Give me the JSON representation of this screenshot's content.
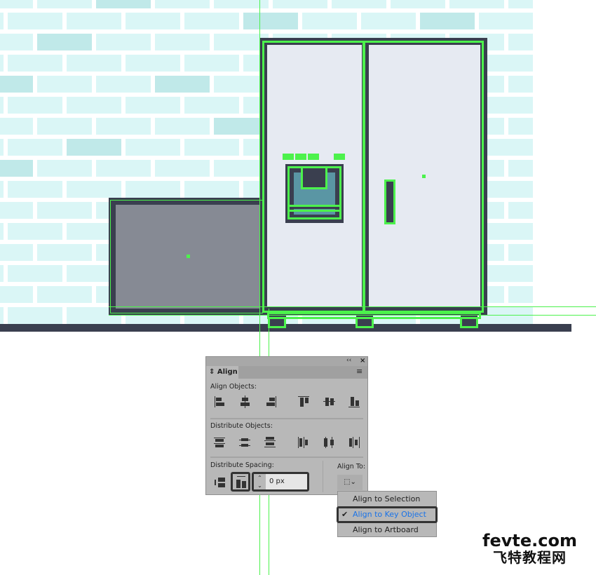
{
  "align_panel": {
    "tab_label": "Align",
    "collapse_icon": "double-chevron-left-icon",
    "close_icon": "close-icon",
    "menu_icon": "hamburger-icon",
    "align_objects_label": "Align Objects:",
    "distribute_objects_label": "Distribute Objects:",
    "distribute_spacing_label": "Distribute Spacing:",
    "align_to_label": "Align To:",
    "spacing_value": "0 px"
  },
  "align_to_menu": {
    "items": [
      {
        "label": "Align to Selection",
        "checked": false
      },
      {
        "label": "Align to Key Object",
        "checked": true
      },
      {
        "label": "Align to Artboard",
        "checked": false
      }
    ]
  },
  "watermark": {
    "line1": "fevte.com",
    "line2": "飞特教程网"
  },
  "colors": {
    "selection": "#4cf24c",
    "dark": "#3a3f4f",
    "fridge_panel": "#e6eaf2",
    "cabinet": "#868a94",
    "brick": "#daf6f6",
    "brick_dark": "#c0e9e9",
    "menu_highlight": "#1a73e8"
  }
}
